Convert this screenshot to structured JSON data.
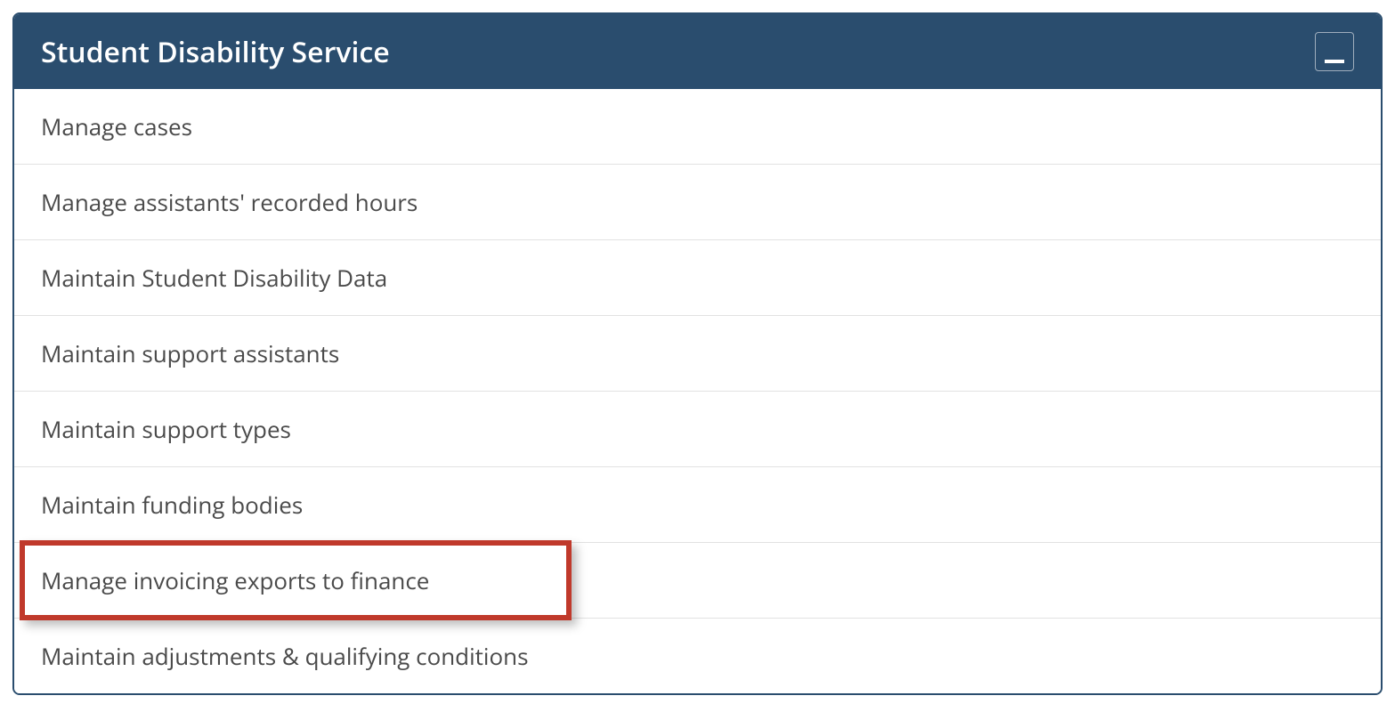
{
  "panel": {
    "title": "Student Disability Service"
  },
  "menu": {
    "items": [
      {
        "label": "Manage cases",
        "highlighted": false
      },
      {
        "label": "Manage assistants' recorded hours",
        "highlighted": false
      },
      {
        "label": "Maintain Student Disability Data",
        "highlighted": false
      },
      {
        "label": "Maintain support assistants",
        "highlighted": false
      },
      {
        "label": "Maintain support types",
        "highlighted": false
      },
      {
        "label": "Maintain funding bodies",
        "highlighted": false
      },
      {
        "label": "Manage invoicing exports to finance",
        "highlighted": true
      },
      {
        "label": "Maintain adjustments & qualifying conditions",
        "highlighted": false
      }
    ]
  }
}
